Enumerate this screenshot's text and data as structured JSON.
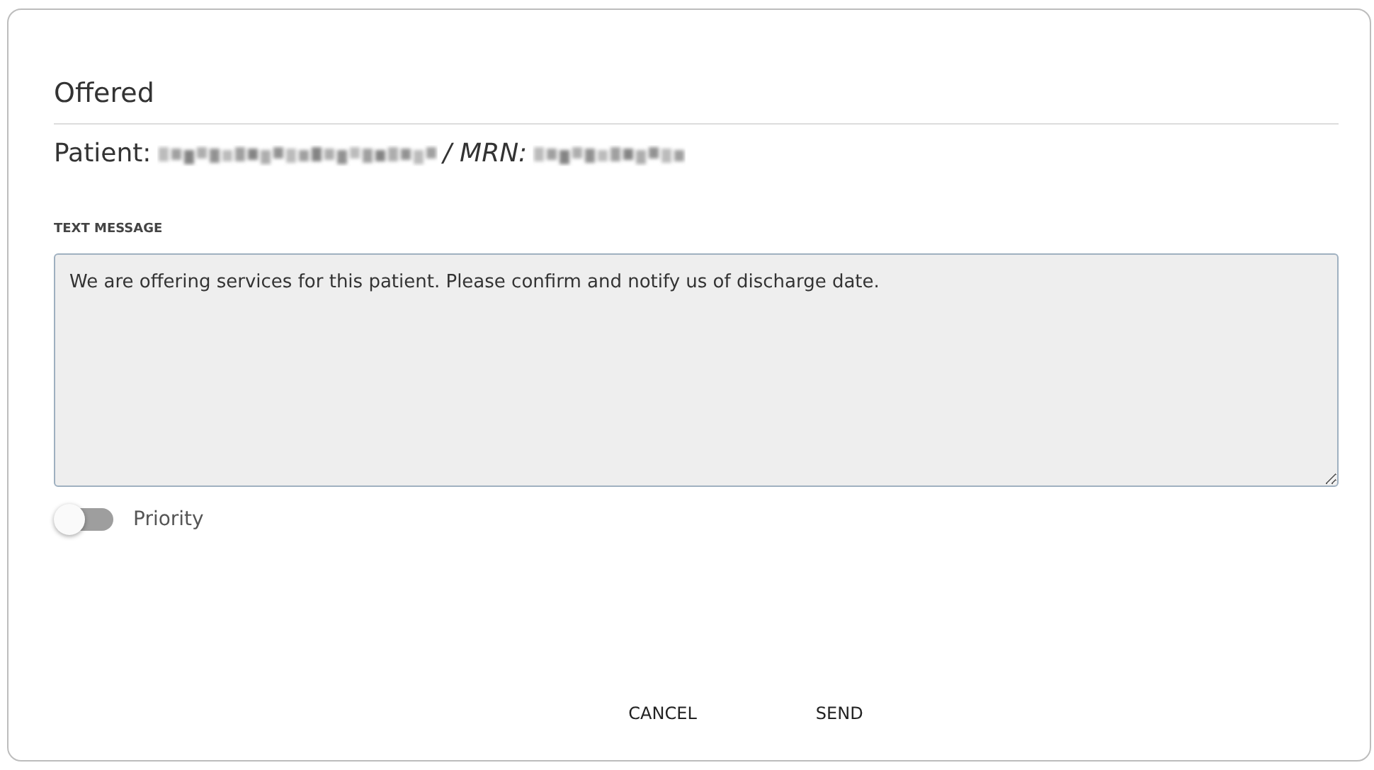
{
  "dialog": {
    "title": "Offered",
    "patient_label": "Patient:",
    "mrn_label": "/ MRN:",
    "message": {
      "label": "TEXT MESSAGE",
      "value": "We are offering services for this patient. Please confirm and notify us of discharge date."
    },
    "priority": {
      "label": "Priority",
      "on": false
    },
    "buttons": [
      "CANCEL",
      "SEND"
    ]
  }
}
